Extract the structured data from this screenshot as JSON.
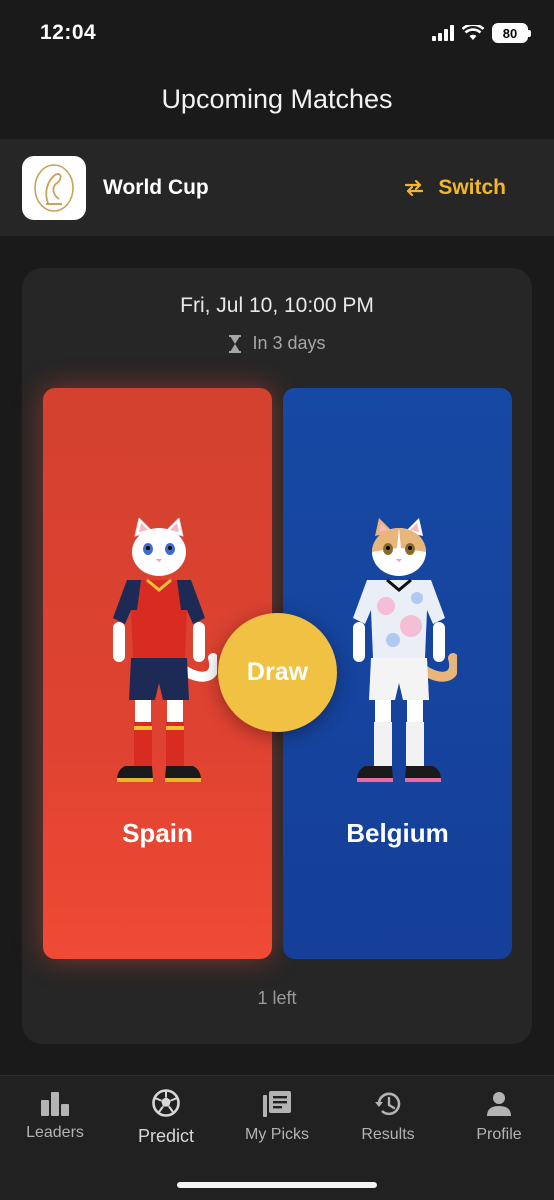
{
  "status_bar": {
    "time": "12:04",
    "battery": "80"
  },
  "header": {
    "title": "Upcoming Matches"
  },
  "tournament": {
    "name": "World Cup",
    "switch_label": "Switch"
  },
  "match": {
    "date": "Fri, Jul 10, 10:00 PM",
    "countdown": "In 3 days",
    "home_team": "Spain",
    "away_team": "Belgium",
    "draw_label": "Draw",
    "picks_left": "1 left",
    "colors": {
      "home": "#df4231",
      "away": "#153f98",
      "draw": "#f0c142",
      "accent": "#f2b62c"
    }
  },
  "nav": {
    "items": [
      {
        "label": "Leaders",
        "icon": "bar-chart-icon"
      },
      {
        "label": "Predict",
        "icon": "soccer-ball-icon"
      },
      {
        "label": "My Picks",
        "icon": "picks-list-icon"
      },
      {
        "label": "Results",
        "icon": "history-icon"
      },
      {
        "label": "Profile",
        "icon": "person-icon"
      }
    ],
    "active": "Predict"
  }
}
